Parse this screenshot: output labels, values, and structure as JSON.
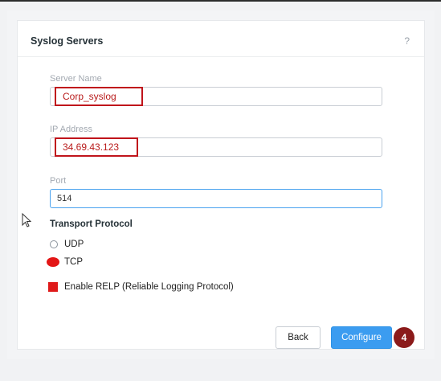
{
  "dialog": {
    "title": "Syslog Servers",
    "help_icon": "?"
  },
  "fields": {
    "server_name": {
      "label": "Server Name",
      "value": "Corp_syslog"
    },
    "ip_address": {
      "label": "IP Address",
      "value": "34.69.43.123"
    },
    "port": {
      "label": "Port",
      "value": "514"
    }
  },
  "transport": {
    "label": "Transport Protocol",
    "options": [
      {
        "label": "UDP",
        "selected": false
      },
      {
        "label": "TCP",
        "selected": true
      }
    ]
  },
  "relp": {
    "label": "Enable RELP (Reliable Logging Protocol)",
    "checked": true
  },
  "buttons": {
    "back": "Back",
    "configure": "Configure"
  },
  "annotation": {
    "step": "4"
  },
  "colors": {
    "accent": "#3b9cf0",
    "highlight": "#c0141b",
    "badge": "#8b1a1a"
  }
}
